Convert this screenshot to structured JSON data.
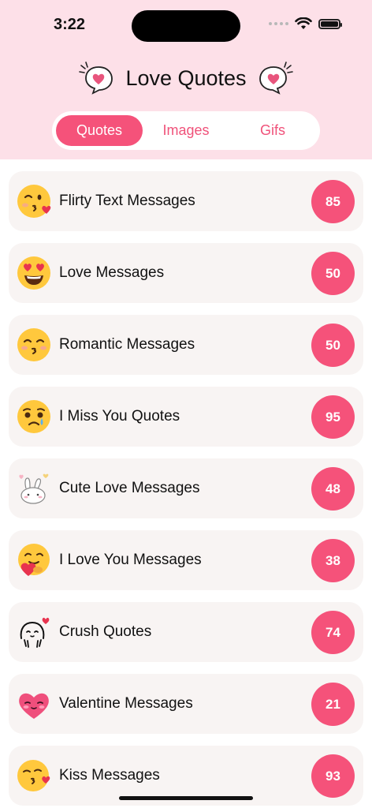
{
  "status": {
    "time": "3:22"
  },
  "header": {
    "title": "Love Quotes"
  },
  "tabs": [
    {
      "label": "Quotes",
      "active": true
    },
    {
      "label": "Images",
      "active": false
    },
    {
      "label": "Gifs",
      "active": false
    }
  ],
  "categories": [
    {
      "label": "Flirty Text Messages",
      "count": "85",
      "icon": "kissing-wink-emoji-icon"
    },
    {
      "label": "Love Messages",
      "count": "50",
      "icon": "heart-eyes-emoji-icon"
    },
    {
      "label": "Romantic Messages",
      "count": "50",
      "icon": "kissing-smiling-emoji-icon"
    },
    {
      "label": "I Miss You Quotes",
      "count": "95",
      "icon": "crying-emoji-icon"
    },
    {
      "label": "Cute Love Messages",
      "count": "48",
      "icon": "bunny-hearts-icon"
    },
    {
      "label": "I Love You Messages",
      "count": "38",
      "icon": "hugging-heart-emoji-icon"
    },
    {
      "label": "Crush Quotes",
      "count": "74",
      "icon": "shy-doodle-heart-icon"
    },
    {
      "label": "Valentine Messages",
      "count": "21",
      "icon": "blushing-heart-face-icon"
    },
    {
      "label": "Kiss Messages",
      "count": "93",
      "icon": "kissing-heart-emoji-icon"
    }
  ],
  "colors": {
    "accent": "#f5527a",
    "header_bg": "#fde0e8",
    "card_bg": "#f8f4f3"
  }
}
